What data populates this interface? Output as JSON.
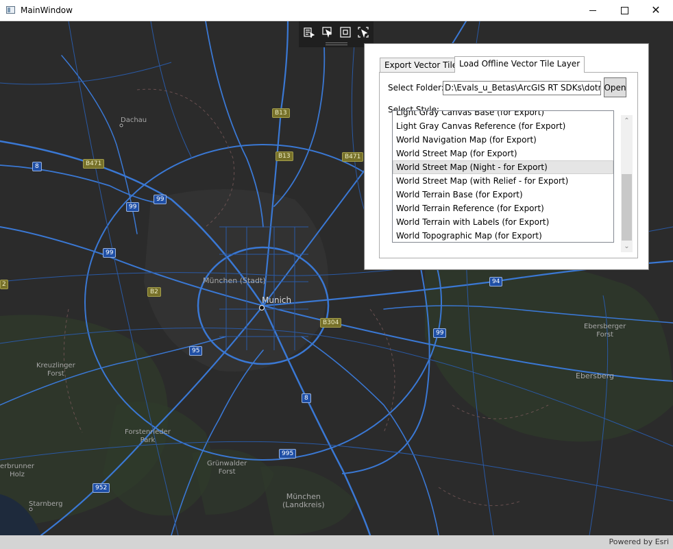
{
  "window": {
    "title": "MainWindow",
    "controls": {
      "minimize_icon": "minimize-icon",
      "maximize_icon": "maximize-icon",
      "close_icon": "close-icon",
      "close_glyph": "✕"
    }
  },
  "toolbar": {
    "tools": [
      {
        "name": "sketch-edit-icon"
      },
      {
        "name": "select-arrow-icon"
      },
      {
        "name": "frame-icon"
      },
      {
        "name": "select-region-icon"
      }
    ]
  },
  "panel": {
    "tabs": [
      {
        "label": "Export Vector Tiles",
        "selected": false
      },
      {
        "label": "Load Offline Vector Tile Layer",
        "selected": true
      }
    ],
    "folder_label": "Select Folder:",
    "folder_value": "D:\\Evals_u_Betas\\ArcGIS RT SDKs\\dotnet\\Q",
    "open_label": "Open",
    "style_label": "Select Style:",
    "styles": [
      "Light Gray Canvas Base (for Export)",
      "Light Gray Canvas Reference (for Export)",
      "World Navigation Map (for Export)",
      "World Street Map (for Export)",
      "World Street Map (Night - for Export)",
      "World Street Map (with Relief - for Export)",
      "World Terrain Base (for Export)",
      "World Terrain Reference (for Export)",
      "World Terrain with Labels (for Export)",
      "World Topographic Map (for Export)"
    ],
    "highlighted_style": "World Street Map (Night - for Export)"
  },
  "map": {
    "city": "Munich",
    "places": {
      "dachau": "Dachau",
      "muenchen_stadt": "München (Stadt)",
      "kreuzlinger_1": "Kreuzlinger",
      "kreuzlinger_2": "Forst",
      "forstenrieder_1": "Forstenrieder",
      "forstenrieder_2": "Park",
      "gruenwalder_1": "Grünwalder",
      "gruenwalder_2": "Forst",
      "muenchen_land_1": "München",
      "muenchen_land_2": "(Landkreis)",
      "ebersberger_1": "Ebersberger",
      "ebersberger_2": "Forst",
      "ebersberg": "Ebersberg",
      "starnberg": "Starnberg",
      "brunner_1": "erbrunner",
      "brunner_2": "Holz"
    },
    "shields": {
      "b13_top": "B13",
      "b13_mid": "B13",
      "b471_left": "B471",
      "b471_right": "B471",
      "a8_west": "8",
      "a99_a": "99",
      "a99_b": "99",
      "a99_c": "99",
      "b2": "B2",
      "b2_edge": "2",
      "a94": "94",
      "b304": "B304",
      "a99_east": "99",
      "a95": "95",
      "a8_south": "8",
      "a995": "995",
      "a952": "952"
    },
    "background": "#2b2b2b",
    "road_color": "#3a78d4"
  },
  "attribution": "Powered by Esri"
}
